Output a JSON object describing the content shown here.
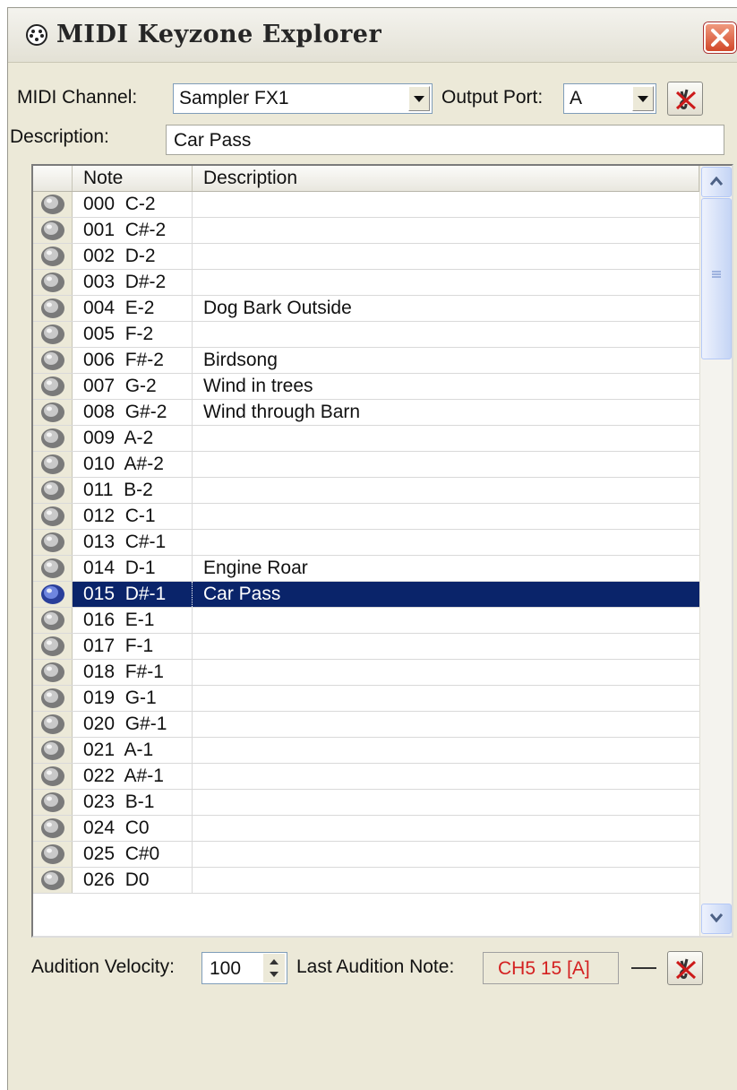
{
  "window": {
    "title": "MIDI Keyzone Explorer"
  },
  "controls": {
    "midi_channel_label": "MIDI Channel:",
    "midi_channel_value": "Sampler FX1",
    "output_port_label": "Output Port:",
    "output_port_value": "A",
    "description_label": "Description:",
    "description_value": "Car Pass"
  },
  "grid": {
    "columns": [
      "Note",
      "Description"
    ],
    "selected_index": 15,
    "rows": [
      {
        "note": "000  C-2",
        "description": ""
      },
      {
        "note": "001  C#-2",
        "description": ""
      },
      {
        "note": "002  D-2",
        "description": ""
      },
      {
        "note": "003  D#-2",
        "description": ""
      },
      {
        "note": "004  E-2",
        "description": "Dog Bark Outside"
      },
      {
        "note": "005  F-2",
        "description": ""
      },
      {
        "note": "006  F#-2",
        "description": "Birdsong"
      },
      {
        "note": "007  G-2",
        "description": "Wind in trees"
      },
      {
        "note": "008  G#-2",
        "description": "Wind through Barn"
      },
      {
        "note": "009  A-2",
        "description": ""
      },
      {
        "note": "010  A#-2",
        "description": ""
      },
      {
        "note": "011  B-2",
        "description": ""
      },
      {
        "note": "012  C-1",
        "description": ""
      },
      {
        "note": "013  C#-1",
        "description": ""
      },
      {
        "note": "014  D-1",
        "description": "Engine Roar"
      },
      {
        "note": "015  D#-1",
        "description": "Car Pass"
      },
      {
        "note": "016  E-1",
        "description": ""
      },
      {
        "note": "017  F-1",
        "description": ""
      },
      {
        "note": "018  F#-1",
        "description": ""
      },
      {
        "note": "019  G-1",
        "description": ""
      },
      {
        "note": "020  G#-1",
        "description": ""
      },
      {
        "note": "021  A-1",
        "description": ""
      },
      {
        "note": "022  A#-1",
        "description": ""
      },
      {
        "note": "023  B-1",
        "description": ""
      },
      {
        "note": "024  C0",
        "description": ""
      },
      {
        "note": "025  C#0",
        "description": ""
      },
      {
        "note": "026  D0",
        "description": ""
      }
    ]
  },
  "footer": {
    "audition_velocity_label": "Audition Velocity:",
    "audition_velocity_value": "100",
    "last_audition_label": "Last Audition Note:",
    "last_audition_value": "CH5 15 [A]"
  },
  "colors": {
    "selection": "#0a246a",
    "last_note_text": "#d42020",
    "close_button": "#d2482a"
  },
  "icons": [
    "app-icon",
    "close-icon",
    "dropdown-arrow-icon",
    "mute-icon",
    "speaker-icon",
    "scroll-up-icon",
    "scroll-down-icon",
    "spin-up-icon",
    "spin-down-icon"
  ]
}
